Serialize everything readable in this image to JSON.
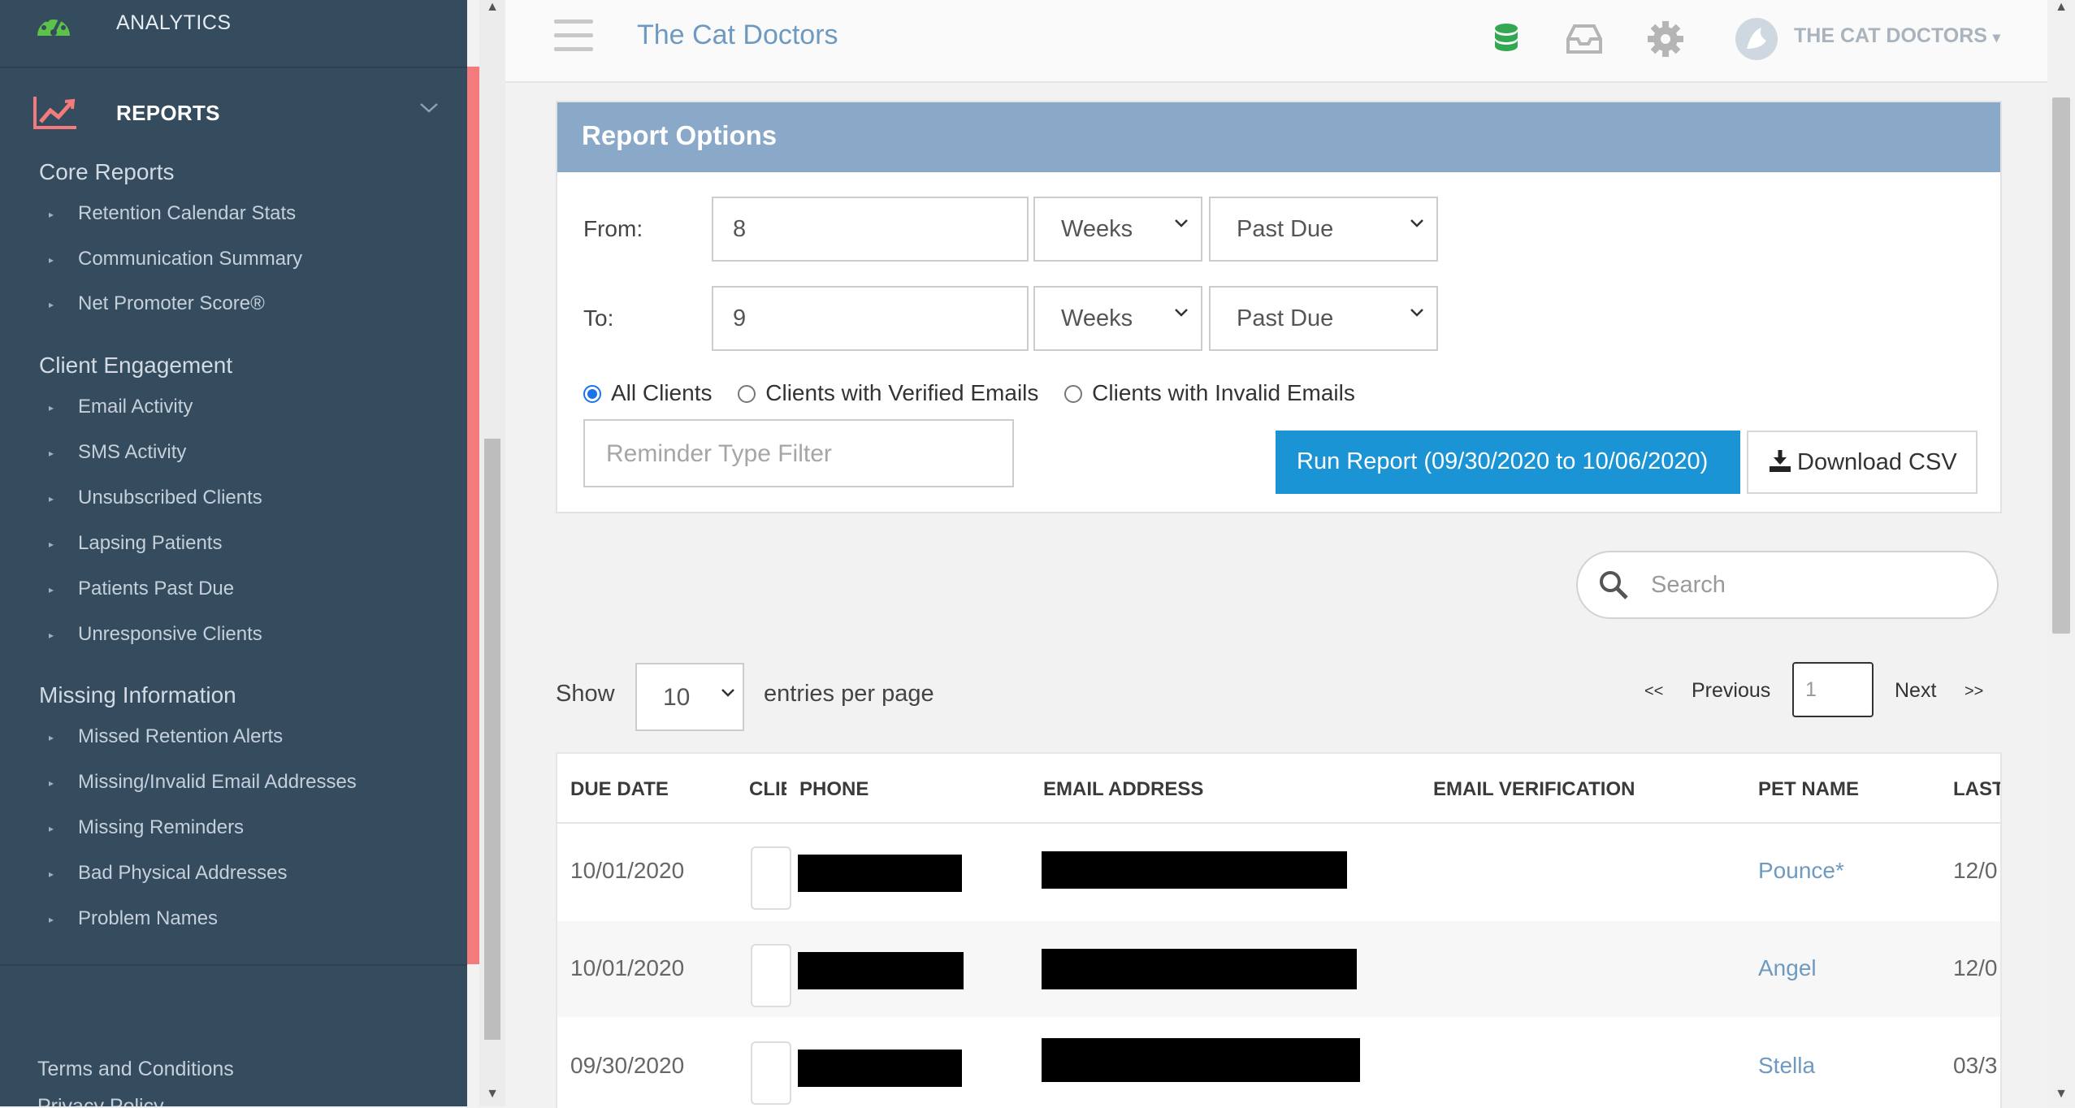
{
  "sidebar": {
    "analytics_label": "ANALYTICS",
    "reports_label": "REPORTS",
    "sections": [
      {
        "title": "Core Reports",
        "items": [
          "Retention Calendar Stats",
          "Communication Summary",
          "Net Promoter Score®"
        ]
      },
      {
        "title": "Client Engagement",
        "items": [
          "Email Activity",
          "SMS Activity",
          "Unsubscribed Clients",
          "Lapsing Patients",
          "Patients Past Due",
          "Unresponsive Clients"
        ]
      },
      {
        "title": "Missing Information",
        "items": [
          "Missed Retention Alerts",
          "Missing/Invalid Email Addresses",
          "Missing Reminders",
          "Bad Physical Addresses",
          "Problem Names"
        ]
      }
    ],
    "footer_links": [
      "Terms and Conditions",
      "Privacy Policy"
    ]
  },
  "topbar": {
    "brand": "The Cat Doctors",
    "user_label": "THE CAT DOCTORS",
    "icons": [
      "database-icon",
      "inbox-icon",
      "gear-icon",
      "user-avatar-icon"
    ]
  },
  "report_options": {
    "title": "Report Options",
    "from_label": "From:",
    "from_value": "8",
    "from_unit": "Weeks",
    "from_status": "Past Due",
    "to_label": "To:",
    "to_value": "9",
    "to_unit": "Weeks",
    "to_status": "Past Due",
    "radios": [
      "All Clients",
      "Clients with Verified Emails",
      "Clients with Invalid Emails"
    ],
    "selected_radio": "All Clients",
    "reminder_placeholder": "Reminder Type Filter",
    "run_button": "Run Report (09/30/2020 to 10/06/2020)",
    "csv_button": "Download CSV"
  },
  "search": {
    "placeholder": "Search"
  },
  "entries": {
    "show_label": "Show",
    "per_page": "10",
    "suffix": "entries per page"
  },
  "pagination": {
    "first": "<<",
    "previous": "Previous",
    "page": "1",
    "next": "Next",
    "last": ">>"
  },
  "table": {
    "columns": [
      "DUE DATE",
      "CLIE",
      "PHONE",
      "EMAIL ADDRESS",
      "EMAIL VERIFICATION",
      "PET NAME",
      "LAST"
    ],
    "rows": [
      {
        "due_date": "10/01/2020",
        "pet_name": "Pounce*",
        "last": "12/0"
      },
      {
        "due_date": "10/01/2020",
        "pet_name": "Angel",
        "last": "12/0"
      },
      {
        "due_date": "09/30/2020",
        "pet_name": "Stella",
        "last": "03/3"
      }
    ]
  },
  "colors": {
    "sidebar_bg": "#354b5e",
    "accent": "#f47b7b",
    "panel_header": "#8aa8c8",
    "primary_button": "#1a94d4",
    "link": "#6e9ac1"
  }
}
